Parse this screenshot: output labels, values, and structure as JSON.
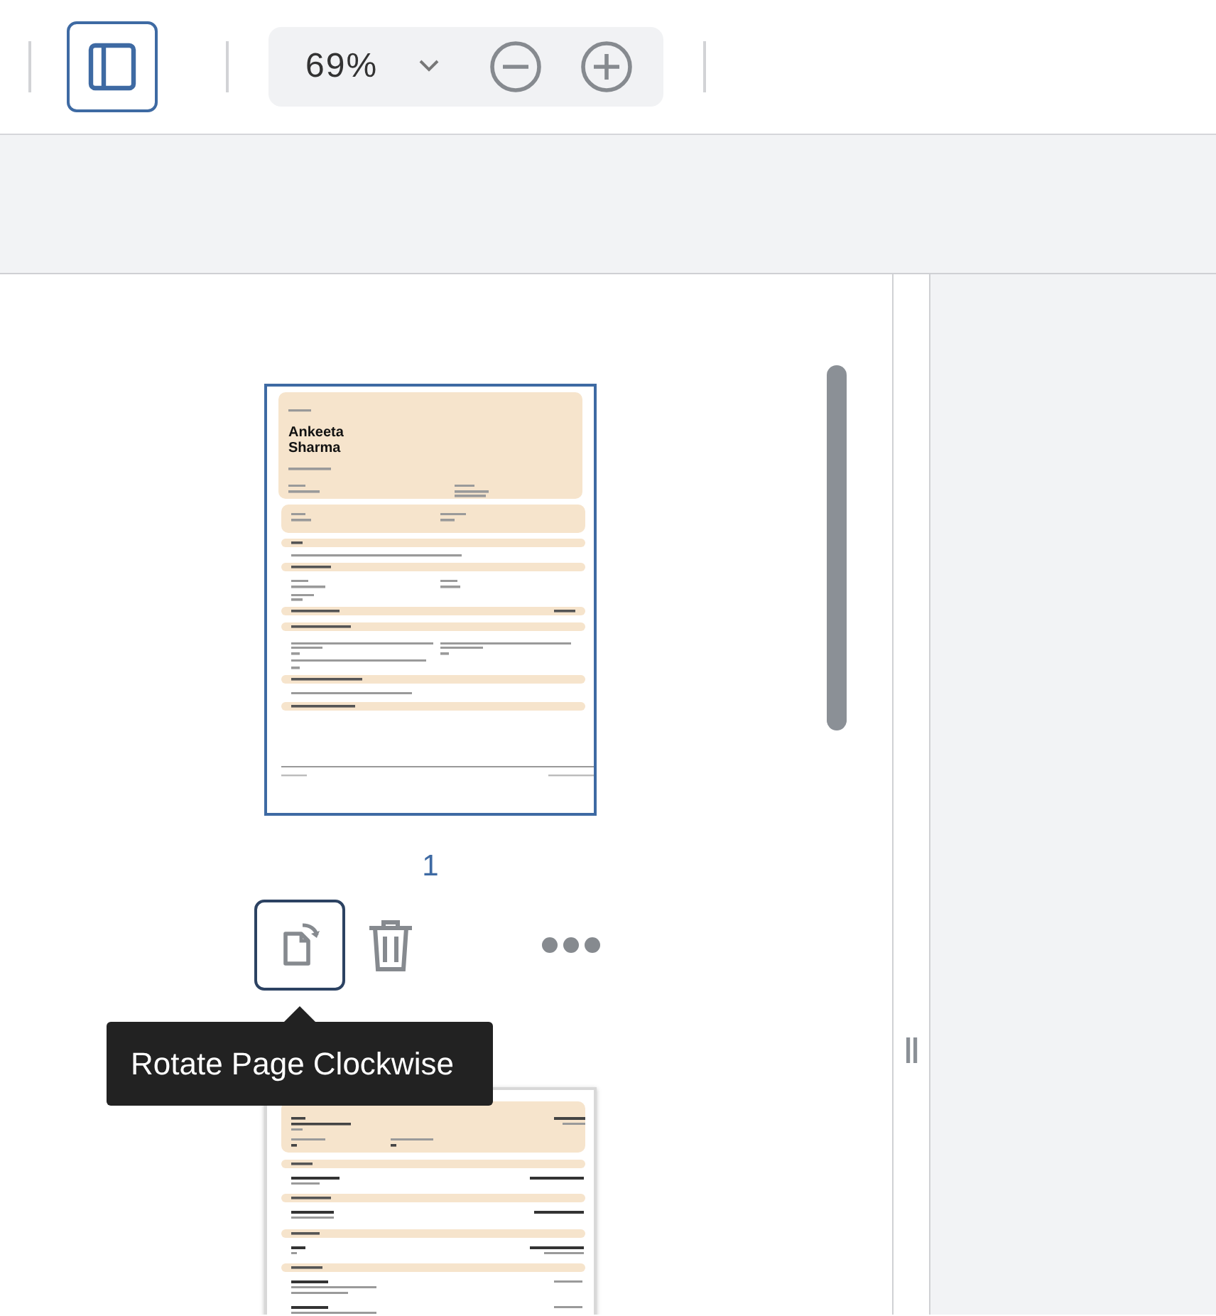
{
  "toolbar": {
    "sidebar_toggle": {
      "selected": true
    },
    "zoom": "69%"
  },
  "pages": [
    {
      "number": "1",
      "selected": true,
      "name": "Ankeeta Sharma",
      "kind": "profile"
    },
    {
      "selected": false,
      "kind": "experience"
    }
  ],
  "tooltip": "Rotate Page Clockwise"
}
